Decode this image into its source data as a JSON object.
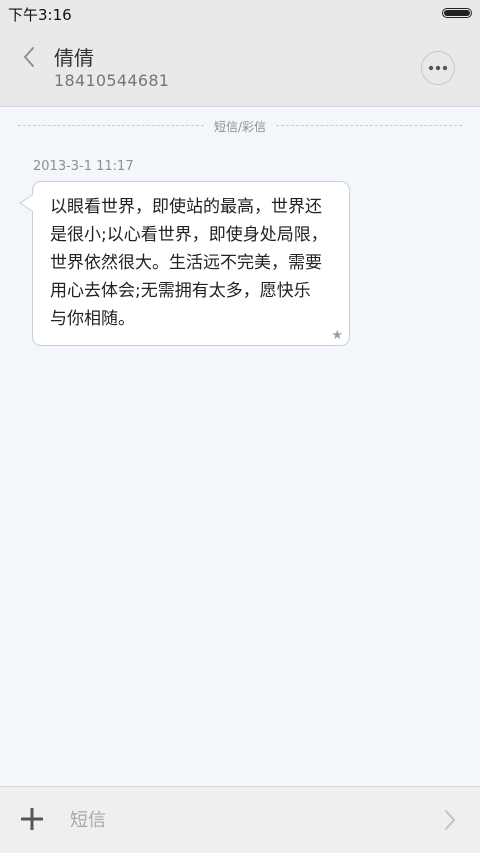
{
  "status_bar": {
    "time": "下午3:16",
    "battery_level": 1.0
  },
  "header": {
    "back_icon": "chevron-left-icon",
    "contact_name": "倩倩",
    "contact_number": "18410544681",
    "more_icon": "more-horizontal-icon"
  },
  "thread": {
    "divider_label": "短信/彩信",
    "messages": [
      {
        "timestamp": "2013-3-1 11:17",
        "text": "以眼看世界，即使站的最高，世界还\n是很小;以心看世界，即使身处局限，\n世界依然很大。生活远不完美，需要\n用心去体会;无需拥有太多，愿快乐\n与你相随。",
        "starred_icon": "star-icon"
      }
    ]
  },
  "composer": {
    "add_icon": "plus-icon",
    "placeholder": "短信",
    "send_icon": "chevron-right-icon"
  },
  "colors": {
    "background": "#f3f7fc",
    "header_bg": "#e9e9e9",
    "bubble_bg": "#ffffff",
    "bubble_border": "#c9ced4"
  }
}
